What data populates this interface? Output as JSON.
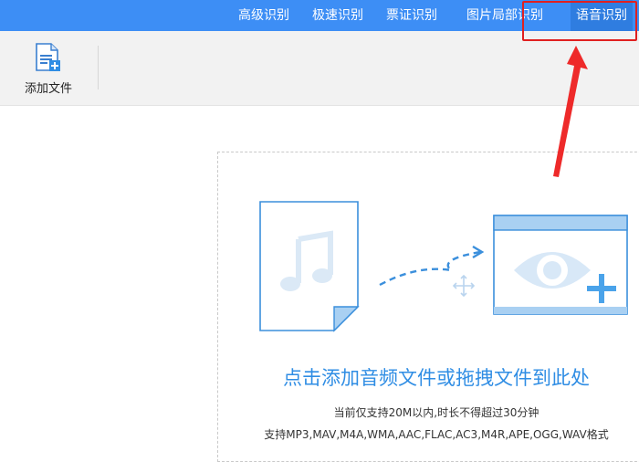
{
  "tabs": [
    {
      "label": "高级识别"
    },
    {
      "label": "极速识别"
    },
    {
      "label": "票证识别"
    },
    {
      "label": "图片局部识别"
    },
    {
      "label": "语音识别",
      "active": true
    }
  ],
  "toolbar": {
    "add_file_label": "添加文件",
    "add_file_icon": "add-file-icon"
  },
  "drop_zone": {
    "title": "点击添加音频文件或拖拽文件到此处",
    "note_size": "当前仅支持20M以内,时长不得超过30分钟",
    "note_formats": "支持MP3,MAV,M4A,WMA,AAC,FLAC,AC3,M4R,APE,OGG,WAV格式"
  },
  "colors": {
    "topbar": "#3d8ef5",
    "active_tab": "#2f7de0",
    "accent": "#2f8de4",
    "annotation": "#e02020"
  },
  "icons": [
    "music-file-icon",
    "drag-arrow-icon",
    "move-cursor-icon",
    "preview-window-icon",
    "eye-icon",
    "plus-icon",
    "red-arrow-annotation"
  ]
}
